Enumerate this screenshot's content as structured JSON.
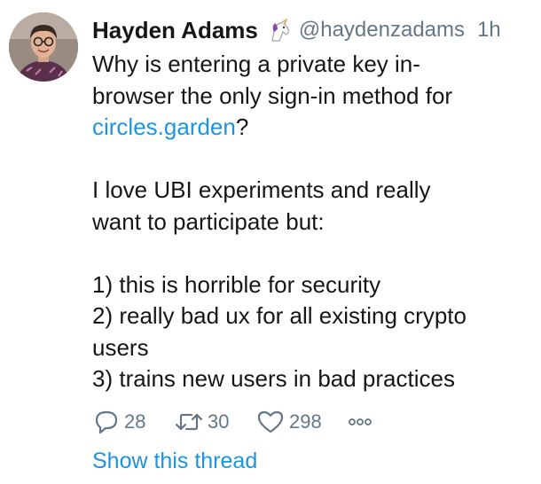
{
  "author": {
    "name": "Hayden Adams",
    "handle": "@haydenzadams",
    "time": "1h",
    "badge_icon": "unicorn-icon"
  },
  "tweet": {
    "line1a": "Why is entering a private key in-",
    "line2a": "browser the only sign-in method for",
    "link": "circles.garden",
    "link_suffix": "?",
    "line4": "I love UBI experiments and really",
    "line5": "want to participate but:",
    "line6": "1) this is horrible for security",
    "line7": "2) really bad ux for all existing crypto",
    "line8": "users",
    "line9": "3) trains new users in bad practices"
  },
  "actions": {
    "reply_count": "28",
    "retweet_count": "30",
    "like_count": "298",
    "reply_icon": "reply-icon",
    "retweet_icon": "retweet-icon",
    "like_icon": "heart-icon",
    "more_icon": "more-icon"
  },
  "thread_link": "Show this thread",
  "colors": {
    "link": "#1b95e0",
    "muted": "#657786",
    "text": "#14171a"
  }
}
